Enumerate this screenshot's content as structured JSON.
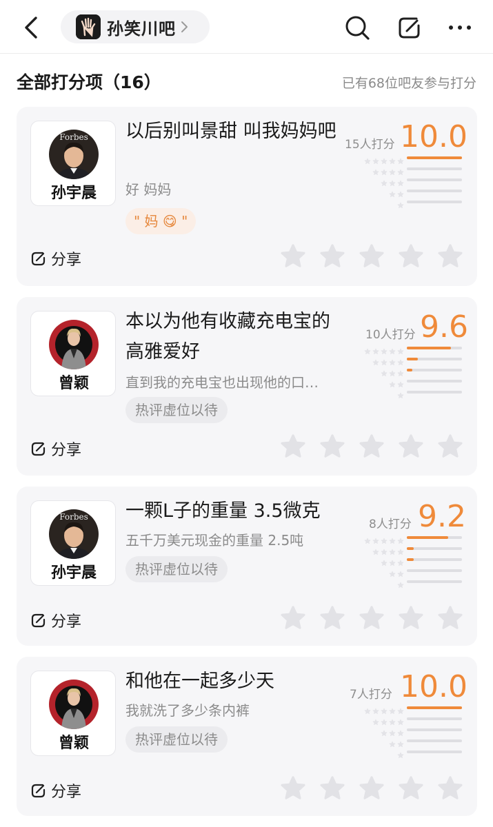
{
  "forum": {
    "name": "孙笑川吧"
  },
  "section": {
    "title": "全部打分项（16）",
    "summary": "已有68位吧友参与打分"
  },
  "share_label": "分享",
  "accent_color": "#ef8a3a",
  "items": [
    {
      "person": "孙宇晨",
      "title": "以后别叫景甜 叫我妈妈吧",
      "subtitle": "好 妈妈",
      "hot_comment": "\" 妈 😋 \"",
      "raters": "15人打分",
      "score": "10.0",
      "distribution": [
        1.0,
        0,
        0,
        0,
        0
      ]
    },
    {
      "person": "曾颖",
      "title": "本以为他有收藏充电宝的高雅爱好",
      "subtitle": "直到我的充电宝也出现他的口…",
      "hot_comment": "热评虚位以待",
      "raters": "10人打分",
      "score": "9.6",
      "distribution": [
        0.8,
        0.2,
        0.1,
        0,
        0
      ]
    },
    {
      "person": "孙宇晨",
      "title": "一颗L子的重量 3.5微克",
      "subtitle": "五千万美元现金的重量 2.5吨",
      "hot_comment": "热评虚位以待",
      "raters": "8人打分",
      "score": "9.2",
      "distribution": [
        0.75,
        0.12,
        0.12,
        0,
        0
      ]
    },
    {
      "person": "曾颖",
      "title": "和他在一起多少天",
      "subtitle": "我就洗了多少条内裤",
      "hot_comment": "热评虚位以待",
      "raters": "7人打分",
      "score": "10.0",
      "distribution": [
        1.0,
        0,
        0,
        0,
        0
      ]
    }
  ]
}
